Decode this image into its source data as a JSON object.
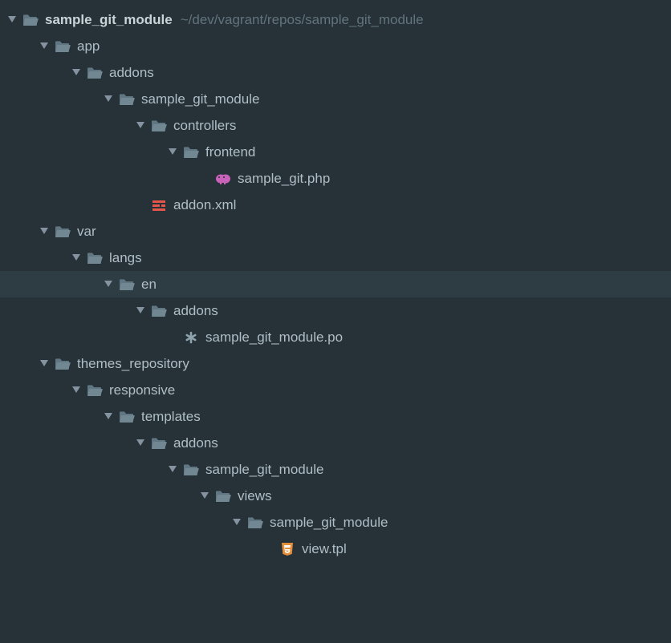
{
  "indentStep": 40,
  "baseIndent": 8,
  "colors": {
    "arrow": "#8593a0",
    "folder": "#617683",
    "openFolder": "#617683",
    "xmlBar": "#e45649",
    "php": "#c863b9",
    "html5": "#e48e38",
    "asterisk": "#8fa3ad"
  },
  "rows": [
    {
      "depth": 0,
      "expanded": true,
      "icon": "folder-open",
      "label": "sample_git_module",
      "bold": true,
      "path": "~/dev/vagrant/repos/sample_git_module",
      "name": "tree-root"
    },
    {
      "depth": 1,
      "expanded": true,
      "icon": "folder-open",
      "label": "app",
      "name": "folder-app"
    },
    {
      "depth": 2,
      "expanded": true,
      "icon": "folder-open",
      "label": "addons",
      "name": "folder-addons"
    },
    {
      "depth": 3,
      "expanded": true,
      "icon": "folder-open",
      "label": "sample_git_module",
      "name": "folder-sample-git-module"
    },
    {
      "depth": 4,
      "expanded": true,
      "icon": "folder-open",
      "label": "controllers",
      "name": "folder-controllers"
    },
    {
      "depth": 5,
      "expanded": true,
      "icon": "folder-open",
      "label": "frontend",
      "name": "folder-frontend"
    },
    {
      "depth": 6,
      "expanded": null,
      "icon": "php",
      "label": "sample_git.php",
      "name": "file-sample-git-php"
    },
    {
      "depth": 4,
      "expanded": null,
      "icon": "xml",
      "label": "addon.xml",
      "name": "file-addon-xml"
    },
    {
      "depth": 1,
      "expanded": true,
      "icon": "folder-open",
      "label": "var",
      "name": "folder-var"
    },
    {
      "depth": 2,
      "expanded": true,
      "icon": "folder-open",
      "label": "langs",
      "name": "folder-langs"
    },
    {
      "depth": 3,
      "expanded": true,
      "icon": "folder-open",
      "label": "en",
      "name": "folder-en",
      "selected": true
    },
    {
      "depth": 4,
      "expanded": true,
      "icon": "folder-open",
      "label": "addons",
      "name": "folder-addons-lang"
    },
    {
      "depth": 5,
      "expanded": null,
      "icon": "asterisk",
      "label": "sample_git_module.po",
      "name": "file-po"
    },
    {
      "depth": 1,
      "expanded": true,
      "icon": "folder-open",
      "label": "themes_repository",
      "name": "folder-themes-repository"
    },
    {
      "depth": 2,
      "expanded": true,
      "icon": "folder-open",
      "label": "responsive",
      "name": "folder-responsive"
    },
    {
      "depth": 3,
      "expanded": true,
      "icon": "folder-open",
      "label": "templates",
      "name": "folder-templates"
    },
    {
      "depth": 4,
      "expanded": true,
      "icon": "folder-open",
      "label": "addons",
      "name": "folder-addons-tpl"
    },
    {
      "depth": 5,
      "expanded": true,
      "icon": "folder-open",
      "label": "sample_git_module",
      "name": "folder-sgm-tpl"
    },
    {
      "depth": 6,
      "expanded": true,
      "icon": "folder-open",
      "label": "views",
      "name": "folder-views"
    },
    {
      "depth": 7,
      "expanded": true,
      "icon": "folder-open",
      "label": "sample_git_module",
      "name": "folder-sgm-views"
    },
    {
      "depth": 8,
      "expanded": null,
      "icon": "html5",
      "label": "view.tpl",
      "name": "file-view-tpl"
    }
  ]
}
